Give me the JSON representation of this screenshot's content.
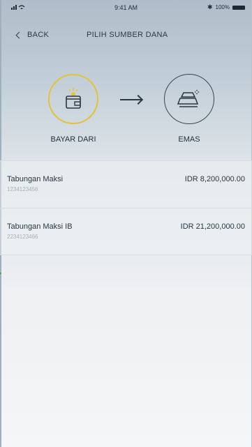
{
  "status_bar": {
    "time": "9:41 AM",
    "battery": "100%",
    "signal_icon": "signal-wifi-icon",
    "bluetooth_icon": "bluetooth-icon"
  },
  "nav": {
    "back_label": "BACK",
    "title": "PILIH SUMBER DANA"
  },
  "flow": {
    "from_label": "BAYAR DARI",
    "to_label": "EMAS",
    "from_icon": "wallet-icon",
    "to_icon": "gold-bars-icon"
  },
  "accounts": [
    {
      "name": "Tabungan Maksi",
      "number": "1234123456",
      "amount": "IDR 8,200,000.00"
    },
    {
      "name": "Tabungan Maksi IB",
      "number": "2234123466",
      "amount": "IDR 21,200,000.00"
    }
  ],
  "colors": {
    "accent": "#e3c33a",
    "text": "#2a3740",
    "muted": "#a7b1b8"
  }
}
